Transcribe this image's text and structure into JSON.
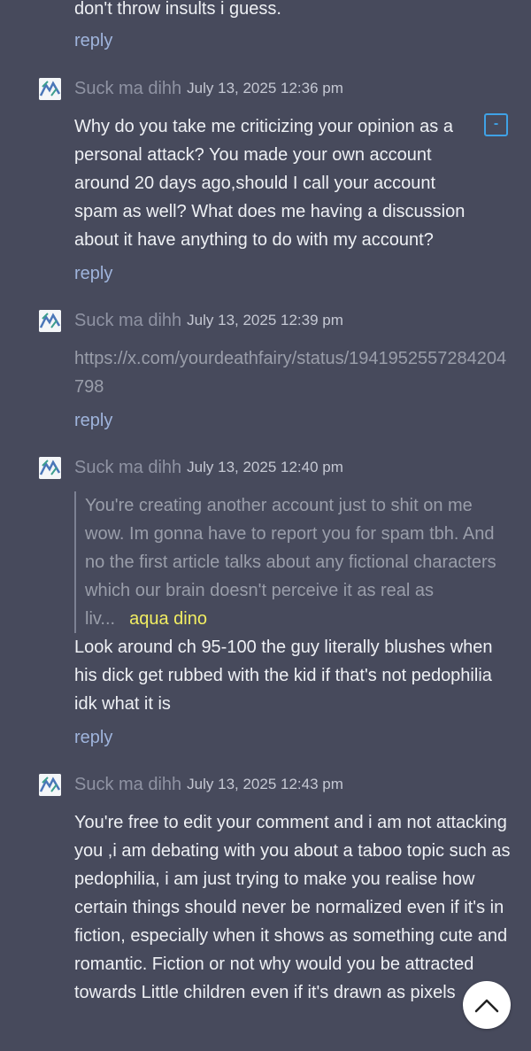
{
  "top_fragment": {
    "text": "don't throw insults i guess.",
    "reply_label": "reply"
  },
  "comments": [
    {
      "author": "Suck ma dihh",
      "timestamp": "July 13, 2025 12:36 pm",
      "body": "Why do you take me criticizing your opinion as a personal attack? You made your own account around 20 days ago,should I call your account spam as well? What does me having a discussion about it have anything to do with my account?",
      "collapse_label": "-",
      "reply_label": "reply"
    },
    {
      "author": "Suck ma dihh",
      "timestamp": "July 13, 2025 12:39 pm",
      "link": "https://x.com/yourdeathfairy/status/1941952557284204798",
      "reply_label": "reply"
    },
    {
      "author": "Suck ma dihh",
      "timestamp": "July 13, 2025 12:40 pm",
      "quote": "You're creating another account just to shit on me wow. Im gonna have to report you for spam tbh. And no the first article talks about any fictional characters which our brain doesn't perceive it as real as liv...",
      "quote_author": "aqua dino",
      "body": "Look around ch 95-100 the guy literally blushes when his dick get rubbed with the kid if that's not pedophilia idk what it is",
      "reply_label": "reply"
    },
    {
      "author": "Suck ma dihh",
      "timestamp": "July 13, 2025 12:43 pm",
      "body": "You're free to edit your comment and i am not attacking you ,i am debating with you about a taboo topic such as pedophilia, i am just trying to make you realise how certain things should never be normalized even if it's in fiction, especially when it shows as something cute and romantic. Fiction or not why would you be attracted towards Little children even if it's drawn as pixels"
    }
  ],
  "colors": {
    "background": "#474a5c",
    "author": "#8f93a3",
    "reply_link": "#9fb4dc",
    "quote_author": "#f2ee62",
    "collapse_accent": "#3fa2e6"
  },
  "icons": {
    "avatar": "identicon-avatar",
    "scroll_top": "chevron-up-icon"
  }
}
